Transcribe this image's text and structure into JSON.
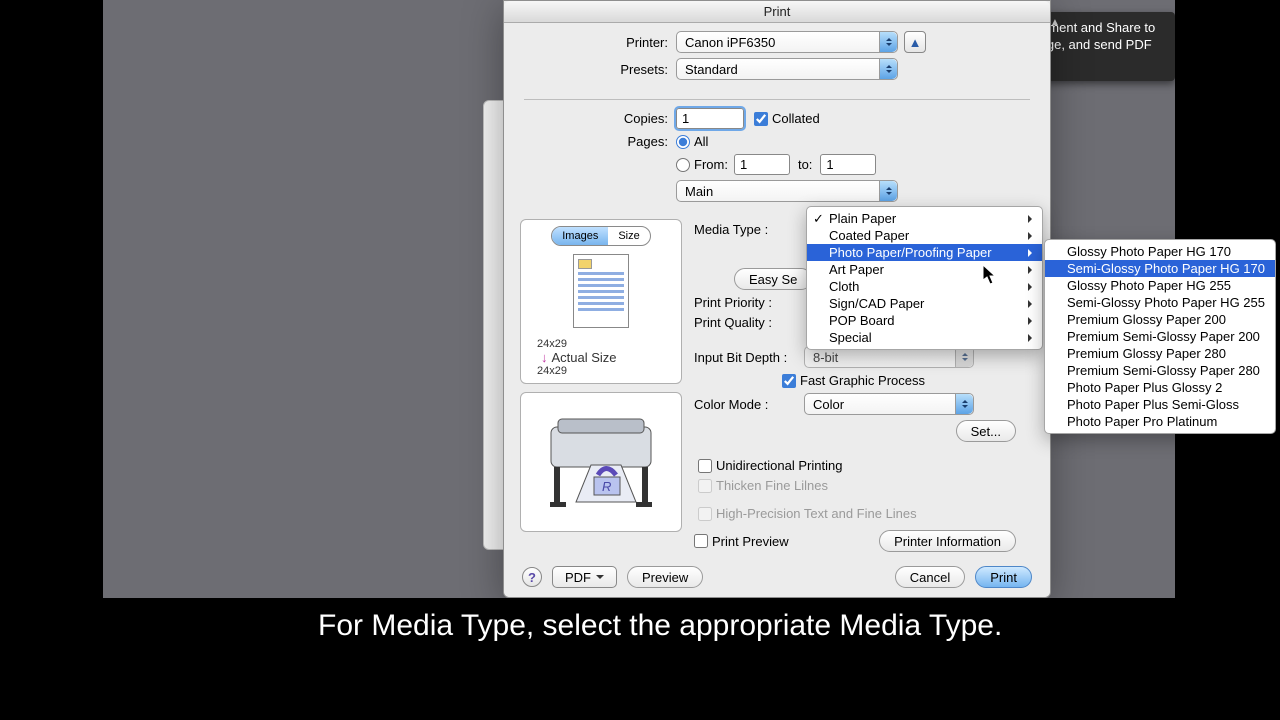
{
  "title": "Print",
  "labels": {
    "printer": "Printer:",
    "presets": "Presets:",
    "copies": "Copies:",
    "collated": "Collated",
    "pages": "Pages:",
    "all": "All",
    "from": "From:",
    "to": "to:",
    "panel": "Main",
    "mediaType": "Media Type :",
    "easySettings": "Easy Se",
    "printPriority": "Print Priority :",
    "printQuality": "Print Quality :",
    "inputBitDepth": "Input Bit Depth :",
    "fastGraphic": "Fast Graphic Process",
    "colorMode": "Color Mode :",
    "setBtn": "Set...",
    "unidir": "Unidirectional Printing",
    "thicken": "Thicken Fine Lilnes",
    "highPrecision": "High-Precision Text and Fine Lines",
    "printPreview": "Print Preview",
    "printerInfo": "Printer Information",
    "pdf": "PDF",
    "preview": "Preview",
    "cancel": "Cancel",
    "print": "Print",
    "images": "Images",
    "size": "Size",
    "actualSize": "Actual Size"
  },
  "values": {
    "printer": "Canon iPF6350",
    "presets": "Standard",
    "copies": "1",
    "pageFrom": "1",
    "pageTo": "1",
    "bitDepth": "8-bit",
    "colorMode": "Color",
    "dim": "24x29"
  },
  "mediaMenu": {
    "items": [
      {
        "label": "Plain Paper",
        "checked": true
      },
      {
        "label": "Coated Paper"
      },
      {
        "label": "Photo Paper/Proofing Paper",
        "selected": true
      },
      {
        "label": "Art Paper"
      },
      {
        "label": "Cloth"
      },
      {
        "label": "Sign/CAD Paper"
      },
      {
        "label": "POP Board"
      },
      {
        "label": "Special"
      }
    ]
  },
  "subMenu": {
    "items": [
      {
        "label": "Glossy Photo Paper HG 170"
      },
      {
        "label": "Semi-Glossy Photo Paper HG 170",
        "selected": true
      },
      {
        "label": "Glossy Photo Paper HG 255"
      },
      {
        "label": "Semi-Glossy Photo Paper HG 255"
      },
      {
        "label": "Premium Glossy Paper 200"
      },
      {
        "label": "Premium Semi-Glossy Paper 200"
      },
      {
        "label": "Premium Glossy Paper 280"
      },
      {
        "label": "Premium Semi-Glossy Paper 280"
      },
      {
        "label": "Photo Paper Plus Glossy 2"
      },
      {
        "label": "Photo Paper Plus Semi-Gloss"
      },
      {
        "label": "Photo Paper Pro Platinum"
      }
    ]
  },
  "tooltip": "Click on Comment and Share to create, manage, and send PDF files.",
  "caption": "For Media Type, select the appropriate Media Type."
}
